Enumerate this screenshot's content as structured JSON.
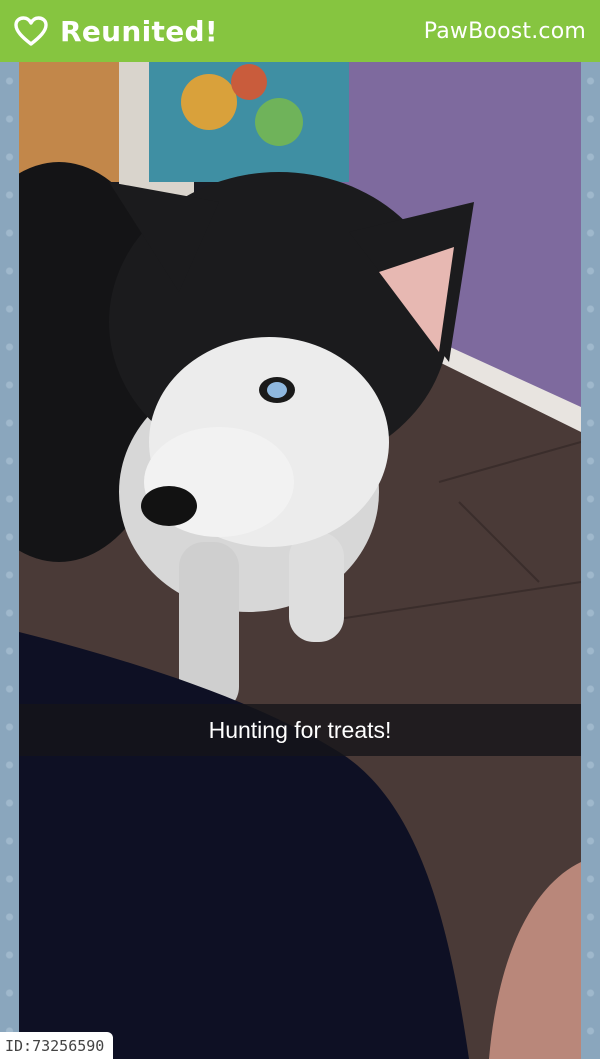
{
  "header": {
    "status": "Reunited!",
    "brand": "PawBoost.com",
    "heart_icon": "heart-outline-icon",
    "background_color": "#86c540"
  },
  "photo": {
    "caption": "Hunting for treats!"
  },
  "footer": {
    "id_prefix": "ID: ",
    "id_value": "73256590"
  },
  "colors": {
    "frame": "#8aa6bd",
    "wall": "#7e6a9e",
    "floor": "#4a3a37"
  }
}
